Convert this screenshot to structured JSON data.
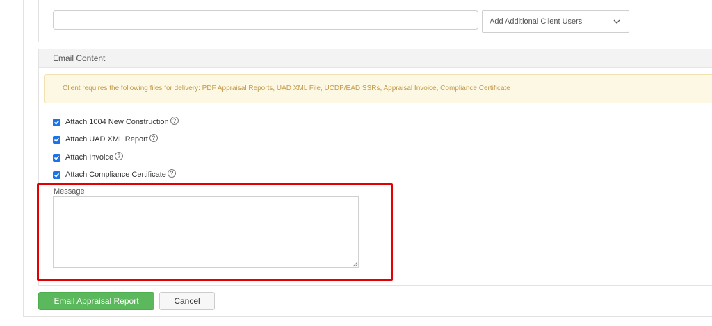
{
  "recipients": {
    "input_value": "",
    "add_client_users_label": "Add Additional Client Users",
    "dropdown_icon": "chevron-down-icon"
  },
  "email_content": {
    "header": "Email Content",
    "notice": "Client requires the following files for delivery: PDF Appraisal Reports, UAD XML File, UCDP/EAD SSRs, Appraisal Invoice, Compliance Certificate",
    "attachments": [
      {
        "label": "Attach 1004 New Construction",
        "checked": true
      },
      {
        "label": "Attach UAD XML Report",
        "checked": true
      },
      {
        "label": "Attach Invoice",
        "checked": true
      },
      {
        "label": "Attach Compliance Certificate",
        "checked": true
      }
    ],
    "help_glyph": "?",
    "message_label": "Message",
    "message_value": ""
  },
  "actions": {
    "primary_label": "Email Appraisal Report",
    "cancel_label": "Cancel"
  },
  "colors": {
    "checkbox": "#1a73e8",
    "primary_button": "#5cb85c",
    "notice_bg": "#fcf8e3",
    "notice_text": "#c39a4a",
    "highlight": "#e30000"
  }
}
